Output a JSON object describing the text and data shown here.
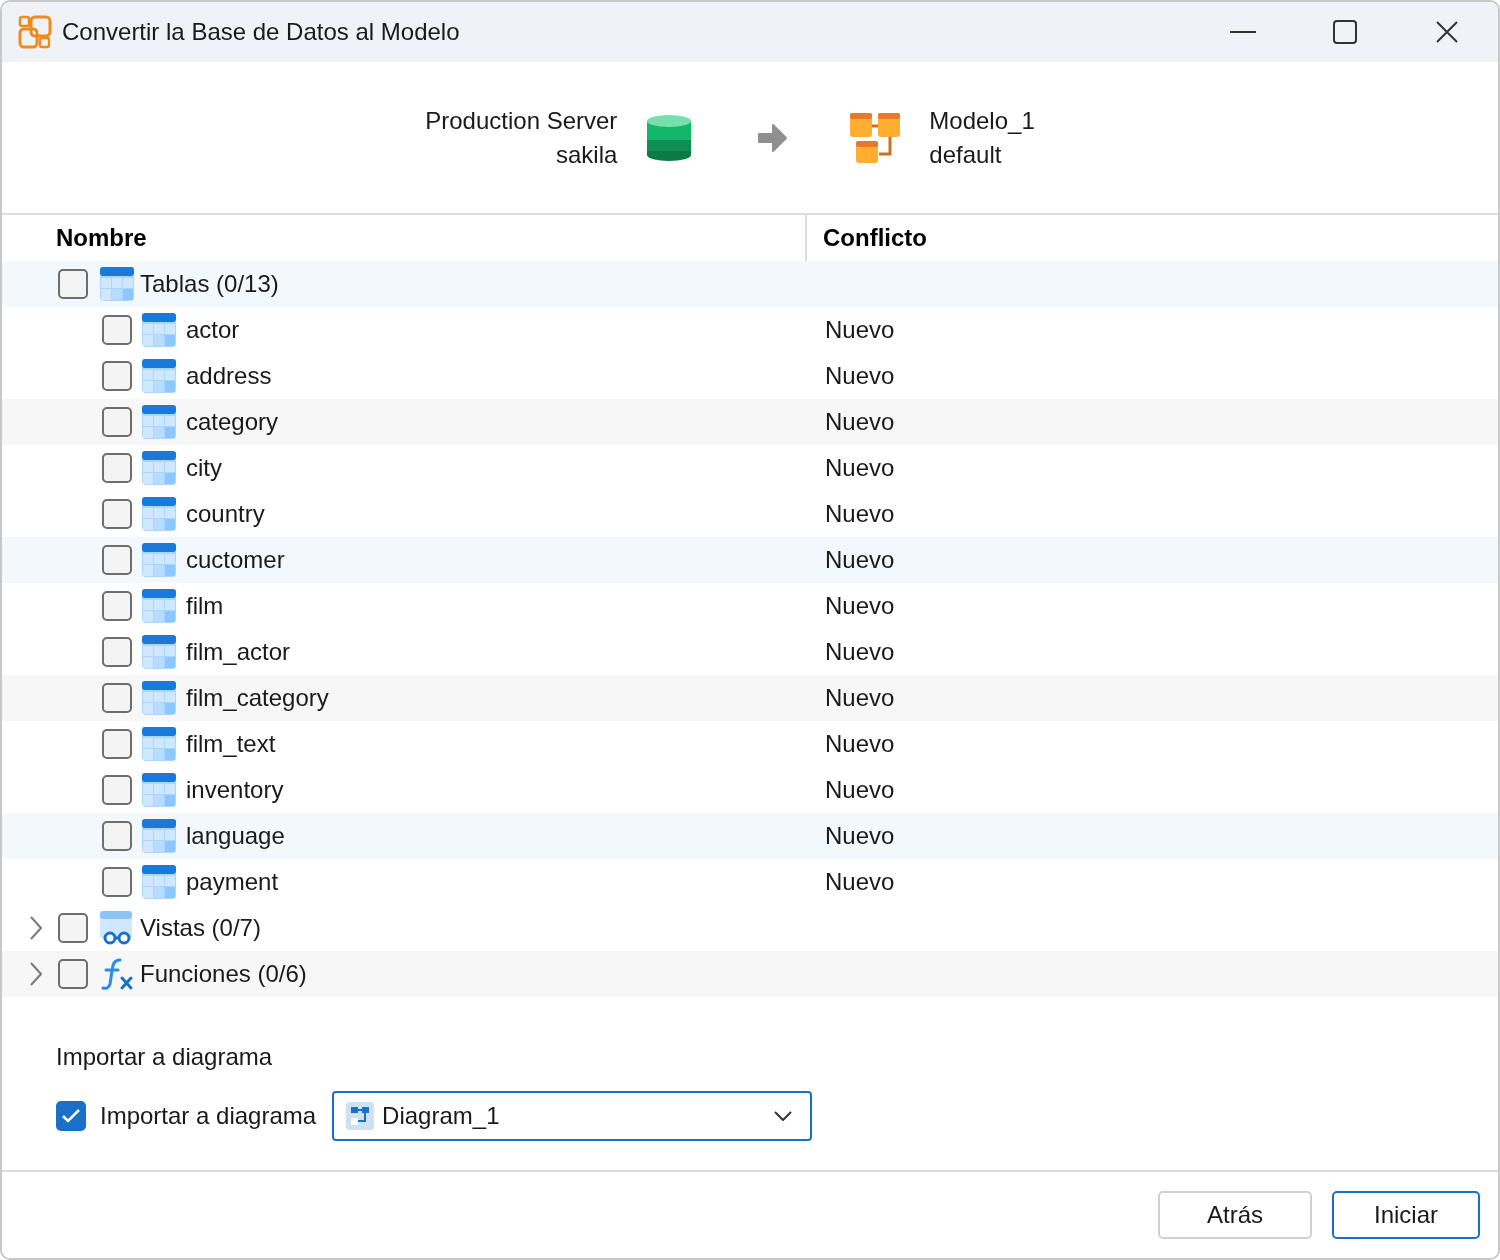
{
  "window": {
    "title": "Convertir la Base de Datos al Modelo"
  },
  "source": {
    "server": "Production Server",
    "database": "sakila"
  },
  "target": {
    "model": "Modelo_1",
    "schema": "default"
  },
  "columns": [
    "Nombre",
    "Conflicto"
  ],
  "groups": [
    {
      "kind": "tables",
      "label": "Tablas (0/13)",
      "checked": false,
      "expanded": true,
      "children": [
        {
          "name": "actor",
          "checked": false,
          "conflict": "Nuevo"
        },
        {
          "name": "address",
          "checked": false,
          "conflict": "Nuevo"
        },
        {
          "name": "category",
          "checked": false,
          "conflict": "Nuevo"
        },
        {
          "name": "city",
          "checked": false,
          "conflict": "Nuevo"
        },
        {
          "name": "country",
          "checked": false,
          "conflict": "Nuevo"
        },
        {
          "name": "cuctomer",
          "checked": false,
          "conflict": "Nuevo"
        },
        {
          "name": "film",
          "checked": false,
          "conflict": "Nuevo"
        },
        {
          "name": "film_actor",
          "checked": false,
          "conflict": "Nuevo"
        },
        {
          "name": "film_category",
          "checked": false,
          "conflict": "Nuevo"
        },
        {
          "name": "film_text",
          "checked": false,
          "conflict": "Nuevo"
        },
        {
          "name": "inventory",
          "checked": false,
          "conflict": "Nuevo"
        },
        {
          "name": "language",
          "checked": false,
          "conflict": "Nuevo"
        },
        {
          "name": "payment",
          "checked": false,
          "conflict": "Nuevo"
        }
      ]
    },
    {
      "kind": "views",
      "label": "Vistas (0/7)",
      "checked": false,
      "expanded": false
    },
    {
      "kind": "functions",
      "label": "Funciones (0/6)",
      "checked": false,
      "expanded": false
    }
  ],
  "import": {
    "section_title": "Importar a diagrama",
    "label": "Importar a diagrama",
    "checked": true,
    "diagram": "Diagram_1"
  },
  "buttons": [
    {
      "label": "Atrás",
      "default": false
    },
    {
      "label": "Iniciar",
      "default": true
    }
  ]
}
